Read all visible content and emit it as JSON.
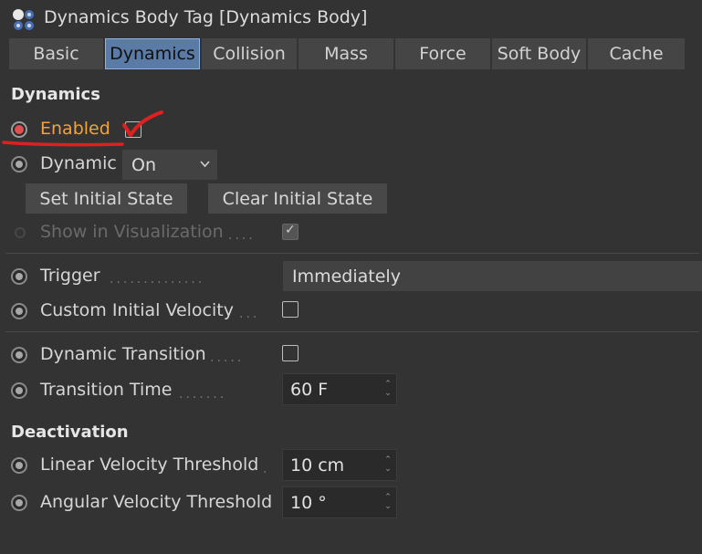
{
  "window": {
    "title": "Dynamics Body Tag [Dynamics Body]"
  },
  "tabs": [
    {
      "label": "Basic"
    },
    {
      "label": "Dynamics"
    },
    {
      "label": "Collision"
    },
    {
      "label": "Mass"
    },
    {
      "label": "Force"
    },
    {
      "label": "Soft Body"
    },
    {
      "label": "Cache"
    }
  ],
  "active_tab": "Dynamics",
  "dynamics": {
    "section_title": "Dynamics",
    "enabled_label": "Enabled",
    "enabled_checked": true,
    "dynamic_label": "Dynamic",
    "dynamic_value": "On",
    "set_initial_state": "Set Initial State",
    "clear_initial_state": "Clear Initial State",
    "show_in_visualization_label": "Show in Visualization",
    "show_in_visualization_checked": true,
    "trigger_label": "Trigger",
    "trigger_value": "Immediately",
    "custom_initial_velocity_label": "Custom Initial Velocity",
    "custom_initial_velocity_checked": false,
    "dynamic_transition_label": "Dynamic Transition",
    "dynamic_transition_checked": false,
    "transition_time_label": "Transition Time",
    "transition_time_value": "60 F"
  },
  "deactivation": {
    "section_title": "Deactivation",
    "linear_velocity_label": "Linear Velocity Threshold",
    "linear_velocity_value": "10 cm",
    "angular_velocity_label": "Angular Velocity Threshold",
    "angular_velocity_value": "10 °"
  },
  "colors": {
    "background": "#333333",
    "active_tab": "#5a7ba6",
    "enabled_label": "#f0a43a",
    "annotation": "#e02020"
  },
  "icons": [
    "dynamics-tag-icon",
    "chevron-down-icon",
    "spinner-arrows-icon",
    "checkmark-icon"
  ]
}
